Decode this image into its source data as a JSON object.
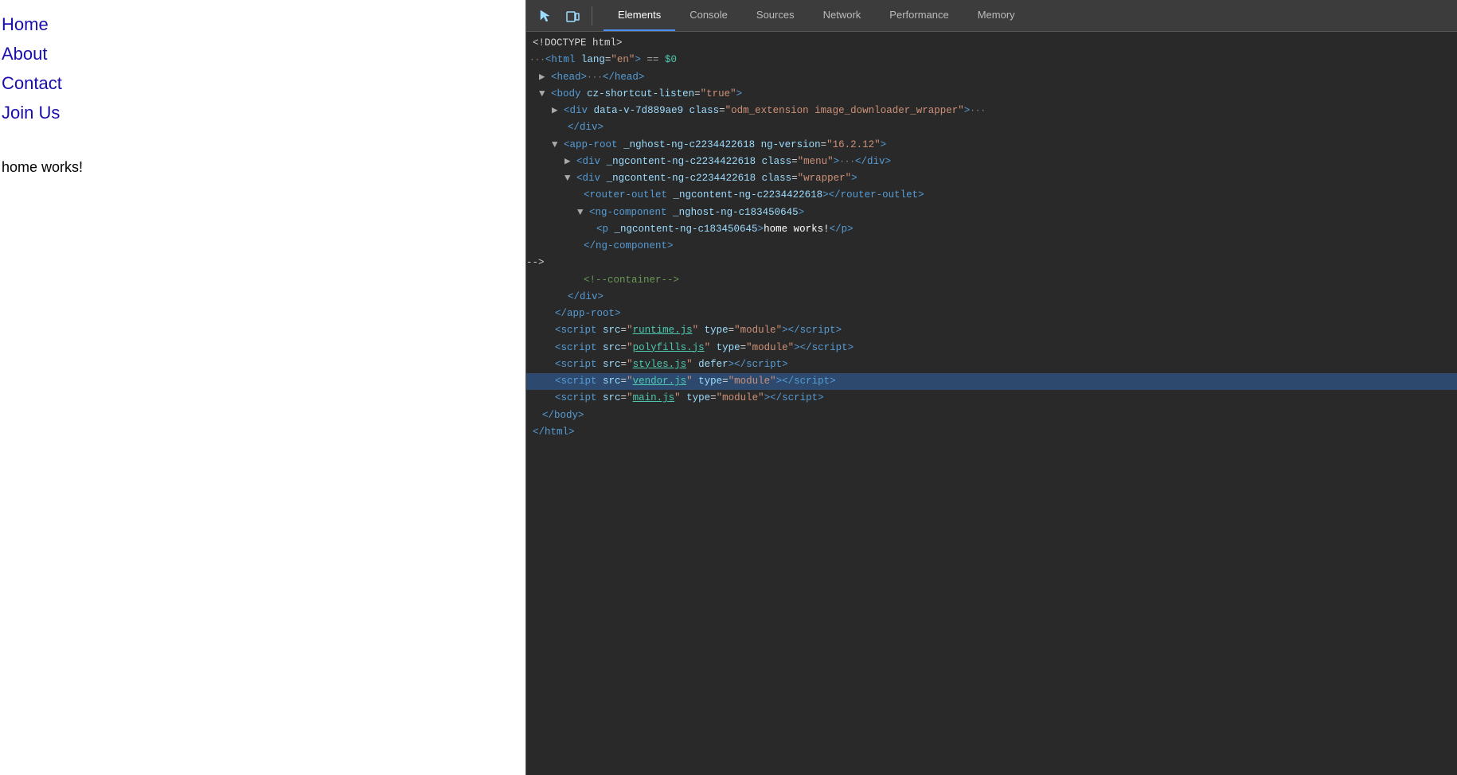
{
  "webpage": {
    "nav_links": [
      {
        "label": "Home"
      },
      {
        "label": "About"
      },
      {
        "label": "Contact"
      },
      {
        "label": "Join Us"
      }
    ],
    "content": "home works!"
  },
  "devtools": {
    "toolbar": {
      "icon_cursor": "⬚",
      "icon_mobile": "▭",
      "tabs": [
        {
          "label": "Elements",
          "active": true
        },
        {
          "label": "Console",
          "active": false
        },
        {
          "label": "Sources",
          "active": false
        },
        {
          "label": "Network",
          "active": false
        },
        {
          "label": "Performance",
          "active": false
        },
        {
          "label": "Memory",
          "active": false
        }
      ]
    },
    "elements_panel": {
      "lines": [
        {
          "indent": 0,
          "text": "<!DOCTYPE html>",
          "type": "doctype"
        },
        {
          "indent": 0,
          "text": "html_root",
          "type": "html_root",
          "selected": false
        },
        {
          "indent": 1,
          "text": "head_collapsed",
          "type": "head_collapsed"
        },
        {
          "indent": 1,
          "text": "body_open",
          "type": "body_open"
        },
        {
          "indent": 2,
          "text": "div_odm",
          "type": "div_odm"
        },
        {
          "indent": 3,
          "text": "div_odm_close",
          "type": "div_odm_close"
        },
        {
          "indent": 2,
          "text": "app_root",
          "type": "app_root"
        },
        {
          "indent": 3,
          "text": "div_menu",
          "type": "div_menu"
        },
        {
          "indent": 3,
          "text": "div_wrapper_open",
          "type": "div_wrapper_open"
        },
        {
          "indent": 4,
          "text": "router_outlet",
          "type": "router_outlet"
        },
        {
          "indent": 4,
          "text": "ng_component_open",
          "type": "ng_component_open"
        },
        {
          "indent": 5,
          "text": "p_home_works",
          "type": "p_home_works"
        },
        {
          "indent": 4,
          "text": "ng_component_close",
          "type": "ng_component_close"
        },
        {
          "indent": 4,
          "text": "comment_container",
          "type": "comment_container"
        },
        {
          "indent": 3,
          "text": "div_wrapper_close",
          "type": "div_wrapper_close"
        },
        {
          "indent": 2,
          "text": "app_root_close",
          "type": "app_root_close"
        },
        {
          "indent": 2,
          "text": "script_runtime",
          "type": "script_runtime"
        },
        {
          "indent": 2,
          "text": "script_polyfills",
          "type": "script_polyfills"
        },
        {
          "indent": 2,
          "text": "script_styles",
          "type": "script_styles"
        },
        {
          "indent": 2,
          "text": "script_vendor",
          "type": "script_vendor",
          "selected": true
        },
        {
          "indent": 2,
          "text": "script_main",
          "type": "script_main"
        },
        {
          "indent": 1,
          "text": "body_close",
          "type": "body_close"
        },
        {
          "indent": 0,
          "text": "html_close",
          "type": "html_close"
        }
      ]
    }
  }
}
